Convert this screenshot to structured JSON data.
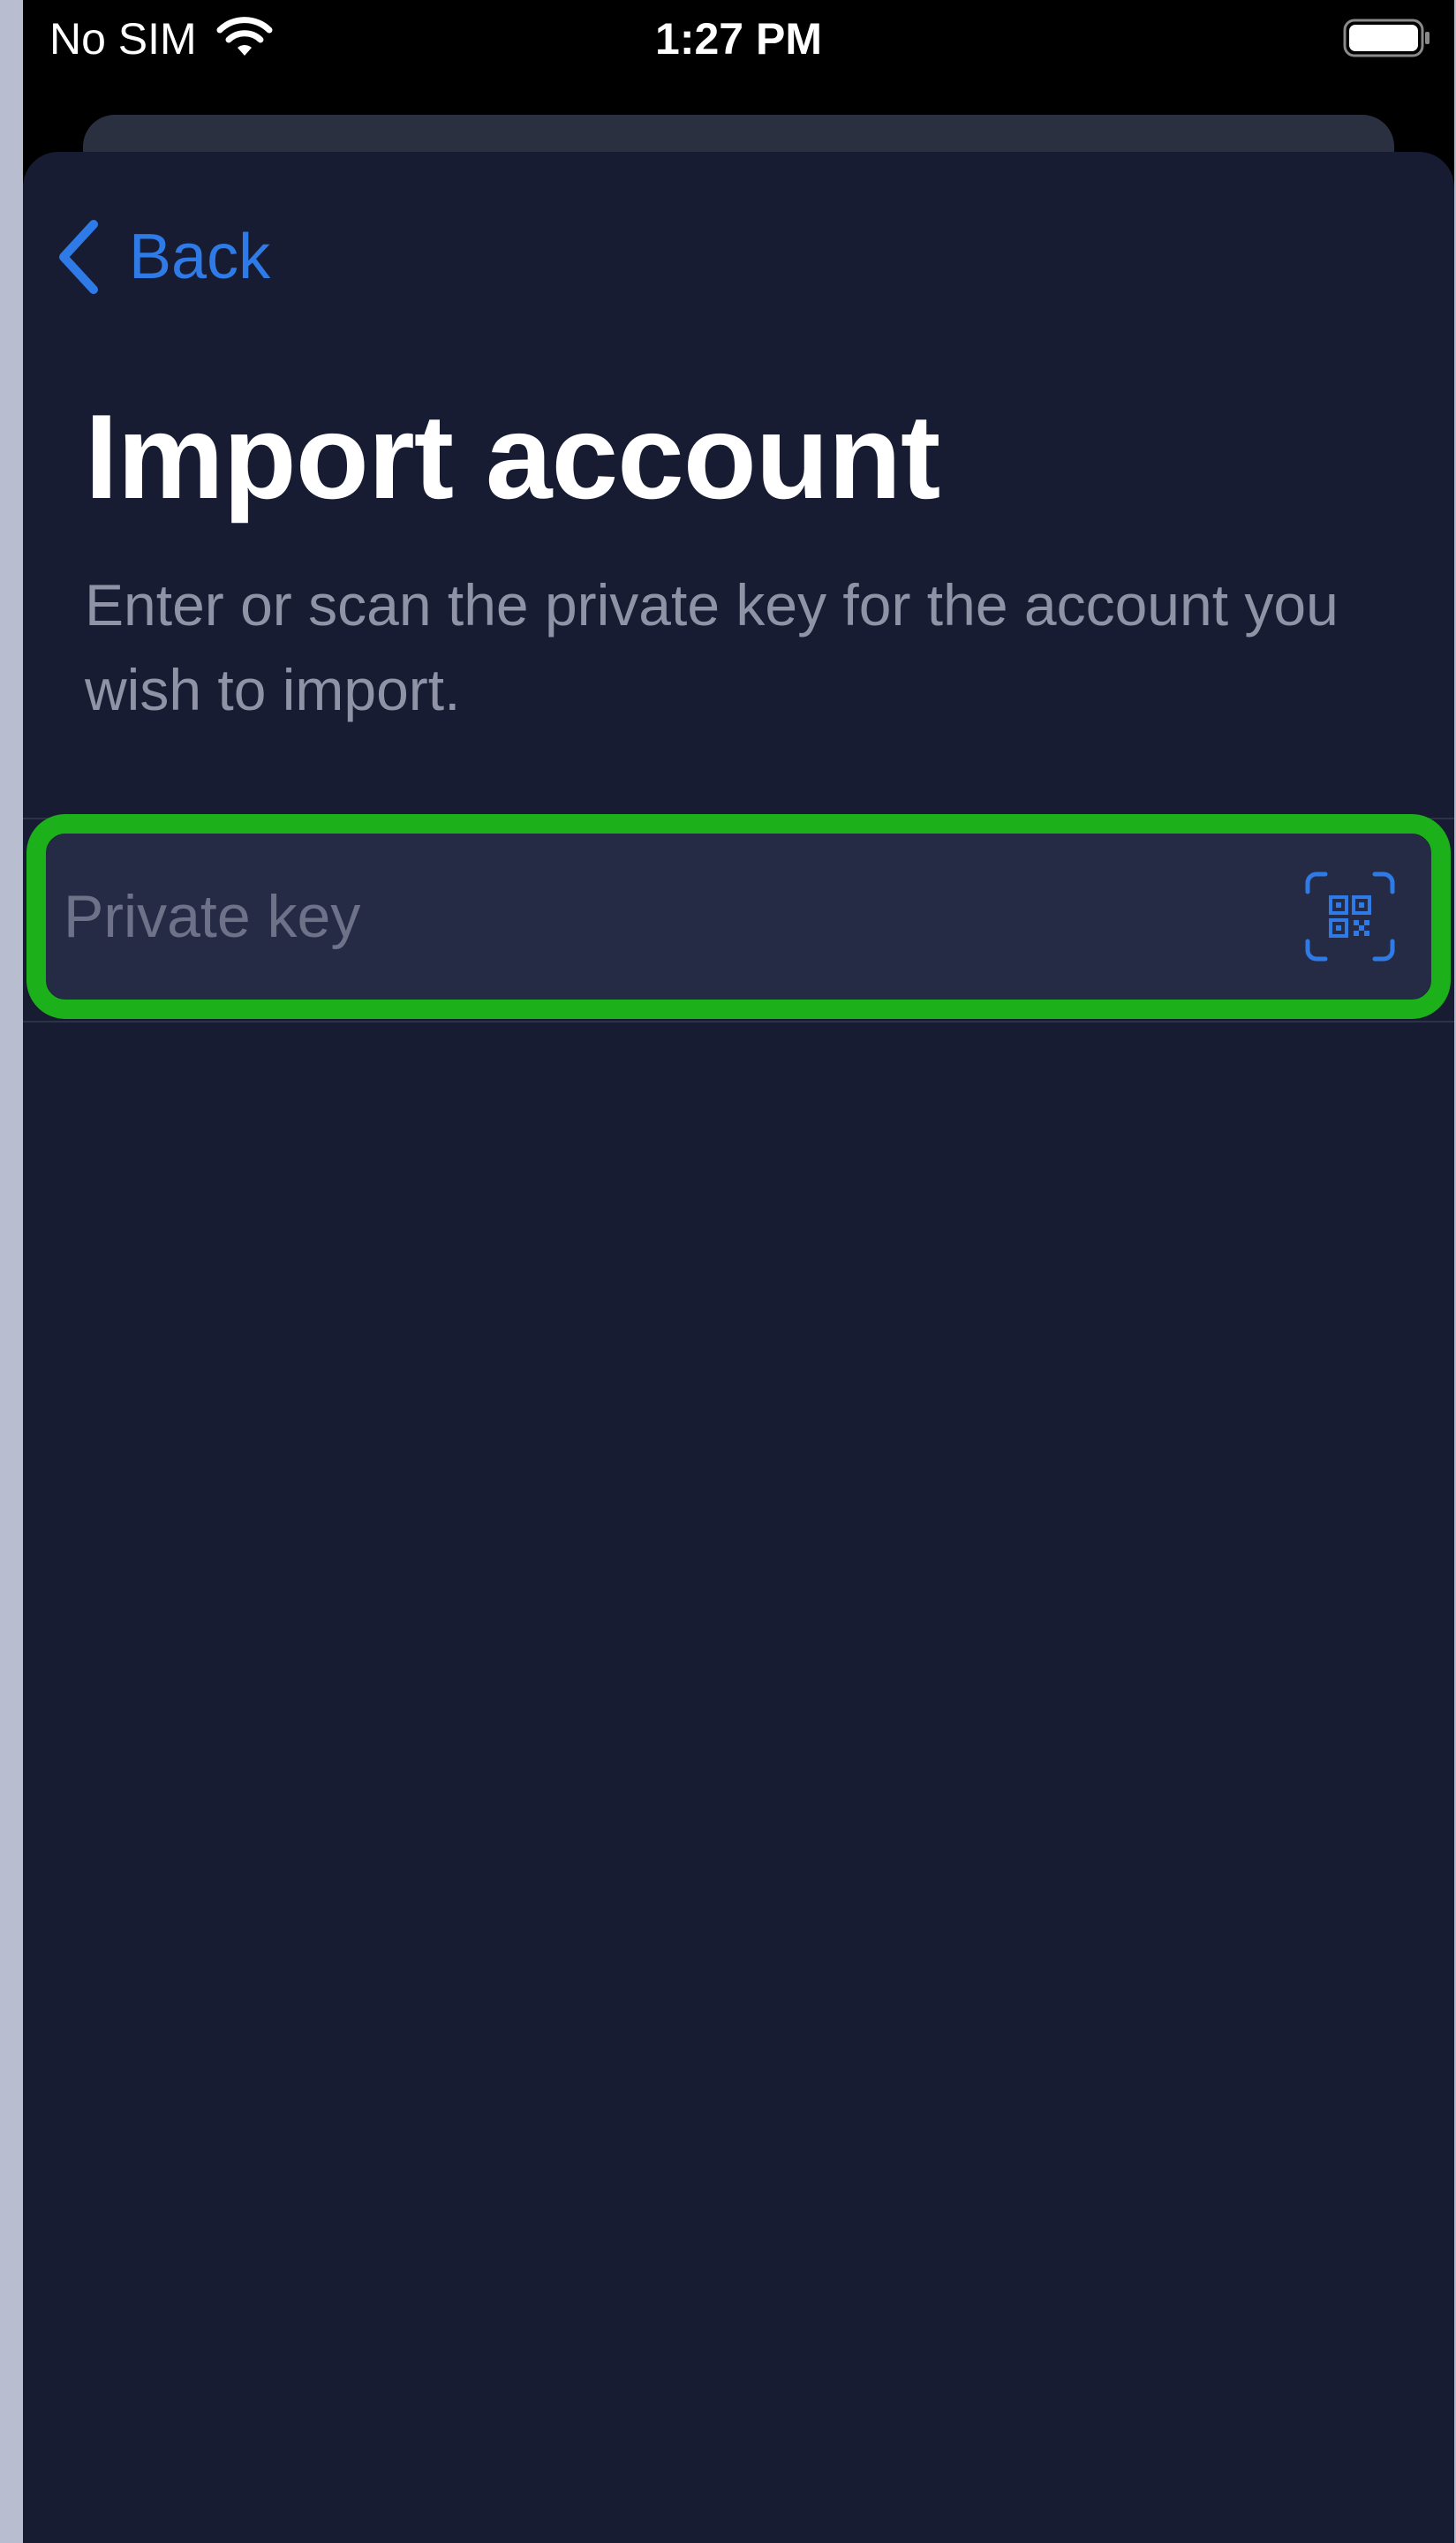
{
  "status_bar": {
    "carrier": "No SIM",
    "time": "1:27 PM"
  },
  "nav": {
    "back_label": "Back"
  },
  "header": {
    "title": "Import account",
    "subtitle": "Enter or scan the private key for the account you wish to import."
  },
  "form": {
    "private_key": {
      "value": "",
      "placeholder": "Private key"
    },
    "scan_icon": "qr-scan-icon"
  },
  "colors": {
    "accent": "#2e7be8",
    "sheet_background": "#181c33",
    "field_background": "#262b45",
    "highlight": "#1cb01b",
    "subtitle_text": "#8f93a5"
  }
}
